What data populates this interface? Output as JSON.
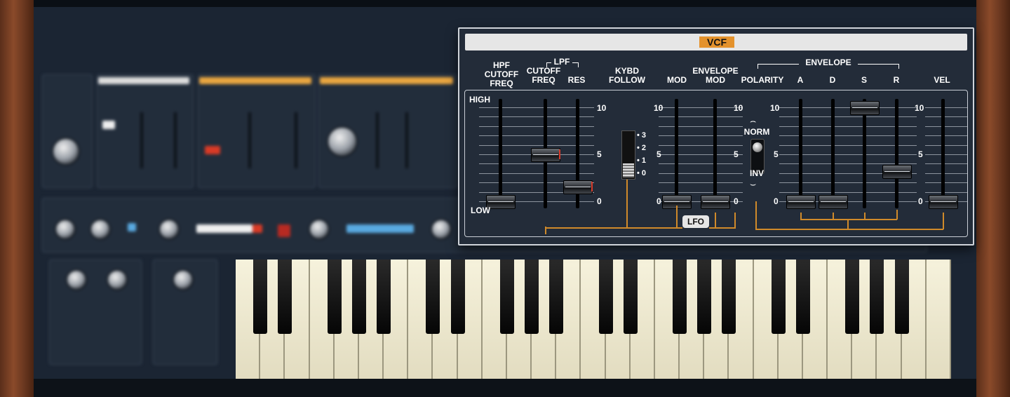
{
  "vcf": {
    "title": "VCF",
    "labels": {
      "hpf": "HPF\nCUTOFF\nFREQ",
      "lpf": "LPF",
      "lpf_cutoff": "CUTOFF\nFREQ",
      "res": "RES",
      "kybd_follow": "KYBD\nFOLLOW",
      "mod": "MOD",
      "envelope_mod": "ENVELOPE\nMOD",
      "envelope": "ENVELOPE",
      "polarity": "POLARITY",
      "a": "A",
      "d": "D",
      "s": "S",
      "r": "R",
      "vel": "VEL",
      "high": "HIGH",
      "low": "LOW",
      "norm": "NORM",
      "inv": "INV",
      "lfo": "LFO"
    },
    "scale": {
      "max": "10",
      "mid": "5",
      "min": "0"
    },
    "kybd_scale": [
      "3",
      "2",
      "1",
      "0"
    ],
    "slider_values": {
      "hpf_cutoff": 0.0,
      "lpf_cutoff": 5.0,
      "res": 1.6,
      "mod": 0.0,
      "envelope_mod": 0.0,
      "attack": 0.0,
      "decay": 0.0,
      "sustain": 10.0,
      "release": 3.2,
      "vel": 0.0
    },
    "kybd_follow_value": 0,
    "polarity": "NORM",
    "accent_color": "#e4922c"
  }
}
